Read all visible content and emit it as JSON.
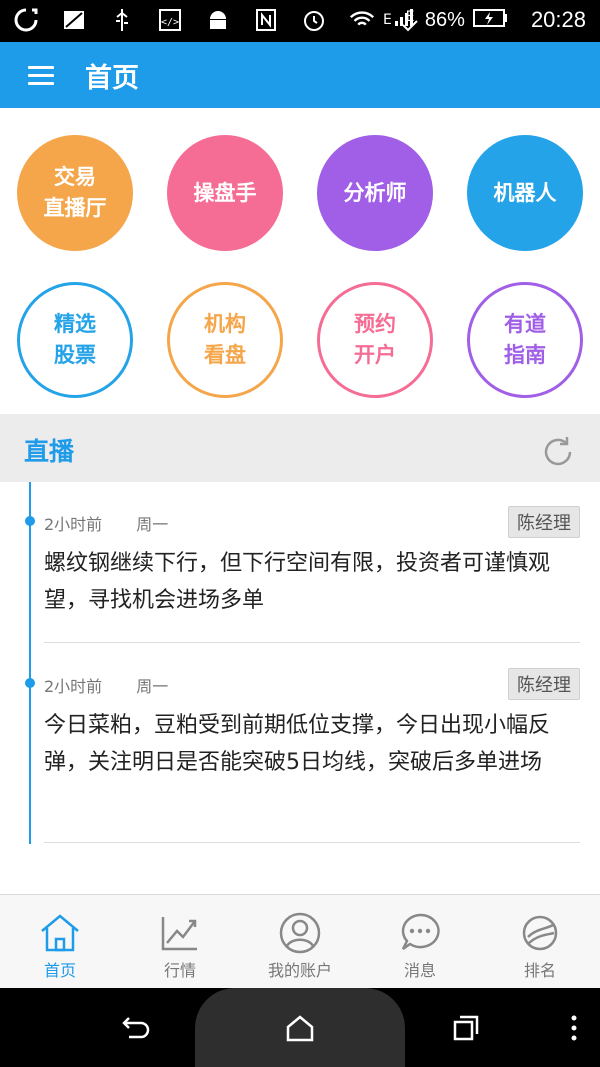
{
  "status_bar": {
    "battery_percent": "86%",
    "time": "20:28"
  },
  "app_bar": {
    "title": "首页"
  },
  "grid": {
    "items": [
      {
        "label": "交易\n直播厅",
        "style": "filled",
        "color": "#f5a64a"
      },
      {
        "label": "操盘手",
        "style": "filled",
        "color": "#f56d95"
      },
      {
        "label": "分析师",
        "style": "filled",
        "color": "#a05fe6"
      },
      {
        "label": "机器人",
        "style": "filled",
        "color": "#25a3e8"
      },
      {
        "label": "精选\n股票",
        "style": "outline",
        "color": "#25a3e8"
      },
      {
        "label": "机构\n看盘",
        "style": "outline",
        "color": "#f5a64a"
      },
      {
        "label": "预约\n开户",
        "style": "outline",
        "color": "#f56d95"
      },
      {
        "label": "有道\n指南",
        "style": "outline",
        "color": "#a05fe6"
      }
    ]
  },
  "live": {
    "title": "直播",
    "posts": [
      {
        "time": "2小时前",
        "day": "周一",
        "author": "陈经理",
        "content": "螺纹钢继续下行，但下行空间有限，投资者可谨慎观望，寻找机会进场多单"
      },
      {
        "time": "2小时前",
        "day": "周一",
        "author": "陈经理",
        "content": "今日菜粕，豆粕受到前期低位支撑，今日出现小幅反弹，关注明日是否能突破5日均线，突破后多单进场"
      }
    ]
  },
  "bottom_nav": {
    "items": [
      {
        "label": "首页",
        "icon": "home-icon",
        "active": true
      },
      {
        "label": "行情",
        "icon": "chart-icon",
        "active": false
      },
      {
        "label": "我的账户",
        "icon": "user-icon",
        "active": false
      },
      {
        "label": "消息",
        "icon": "message-icon",
        "active": false
      },
      {
        "label": "排名",
        "icon": "ranking-icon",
        "active": false
      }
    ]
  },
  "colors": {
    "primary": "#1e9be9",
    "orange": "#f5a64a",
    "pink": "#f56d95",
    "purple": "#a05fe6",
    "blue": "#25a3e8"
  }
}
